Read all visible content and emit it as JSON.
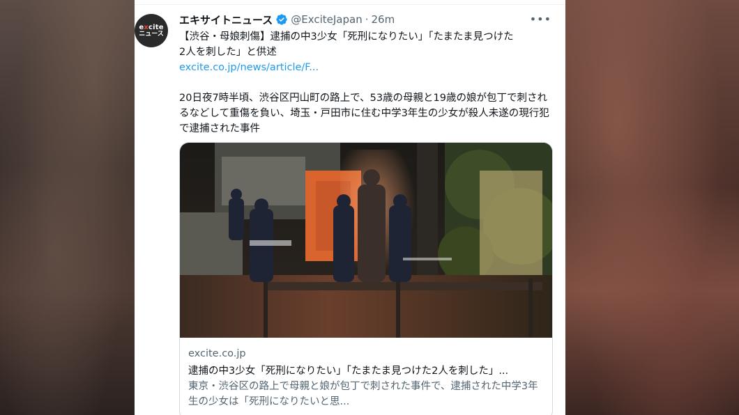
{
  "tweet": {
    "avatar": {
      "line1_a": "e",
      "line1_x": "x",
      "line1_b": "cite",
      "line2": "ニュース"
    },
    "display_name": "エキサイトニュース",
    "handle": "@ExciteJapan",
    "separator": "·",
    "time": "26m",
    "more": "•••",
    "text": {
      "line1": "【渋谷・母娘刺傷】逮捕の中3少女「死刑になりたい」「たまたま見つけた",
      "line2": "2人を刺した」と供述",
      "link": "excite.co.jp/news/article/F...",
      "para2": "20日夜7時半頃、渋谷区円山町の路上で、53歳の母親と19歳の娘が包丁で刺されるなどして重傷を負い、埼玉・戸田市に住む中学3年生の少女が殺人未遂の現行犯で逮捕された事件"
    },
    "card": {
      "domain": "excite.co.jp",
      "title": "逮捕の中3少女「死刑になりたい」「たまたま見つけた2人を刺した」...",
      "description": "東京・渋谷区の路上で母親と娘が包丁で刺された事件で、逮捕された中学3年生の少女は「死刑になりたいと思..."
    }
  },
  "colors": {
    "link": "#1d9bf0",
    "text_primary": "#0f1419",
    "text_secondary": "#536471",
    "verified": "#1d9bf0",
    "card_border": "#cfd9de"
  },
  "icons": [
    "verified-badge-icon",
    "more-options-icon"
  ]
}
